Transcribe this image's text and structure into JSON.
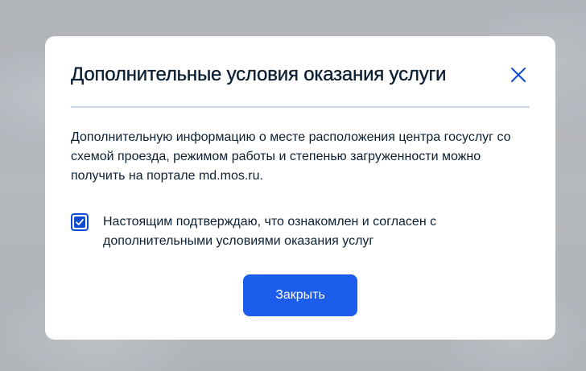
{
  "modal": {
    "title": "Дополнительные условия оказания услуги",
    "text": "Дополнительную информацию о месте расположения центра госуслуг со схемой проезда, режимом работы и степенью загруженности можно получить на портале md.mos.ru.",
    "checkbox": {
      "checked": true,
      "label": "Настоящим подтверждаю, что ознакомлен и согласен с дополнительными условиями оказания услуг"
    },
    "close_button_label": "Закрыть",
    "close_icon": "close-icon"
  },
  "colors": {
    "accent": "#0d4cd3",
    "button": "#1d5deb",
    "text": "#0b1f33",
    "divider": "#c9d6e8"
  }
}
